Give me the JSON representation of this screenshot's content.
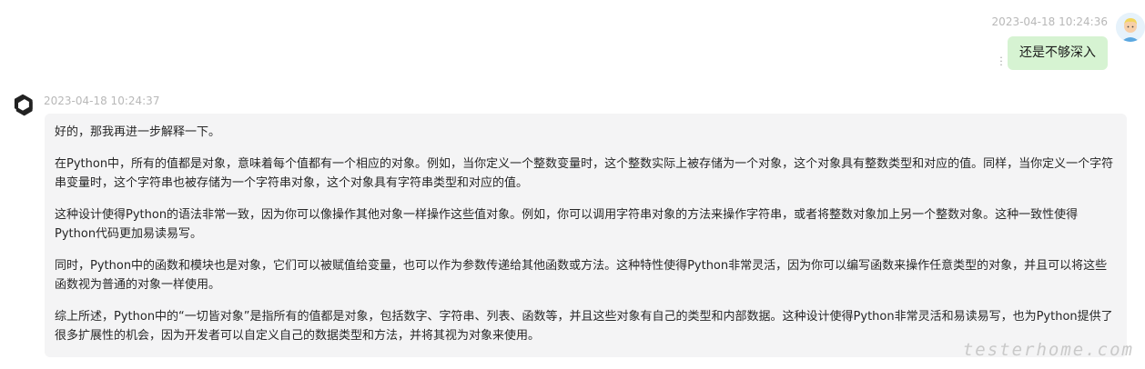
{
  "user_message": {
    "timestamp": "2023-04-18 10:24:36",
    "text": "还是不够深入",
    "avatar_icon": "user-avatar-icon",
    "bubble_color": "#d6f3d2"
  },
  "ai_message": {
    "timestamp": "2023-04-18 10:24:37",
    "avatar_icon": "openai-logo-icon",
    "bubble_color": "#f4f4f5",
    "paragraphs": [
      "好的，那我再进一步解释一下。",
      "在Python中，所有的值都是对象，意味着每个值都有一个相应的对象。例如，当你定义一个整数变量时，这个整数实际上被存储为一个对象，这个对象具有整数类型和对应的值。同样，当你定义一个字符串变量时，这个字符串也被存储为一个字符串对象，这个对象具有字符串类型和对应的值。",
      "这种设计使得Python的语法非常一致，因为你可以像操作其他对象一样操作这些值对象。例如，你可以调用字符串对象的方法来操作字符串，或者将整数对象加上另一个整数对象。这种一致性使得Python代码更加易读易写。",
      "同时，Python中的函数和模块也是对象，它们可以被赋值给变量，也可以作为参数传递给其他函数或方法。这种特性使得Python非常灵活，因为你可以编写函数来操作任意类型的对象，并且可以将这些函数视为普通的对象一样使用。",
      "综上所述，Python中的“一切皆对象”是指所有的值都是对象，包括数字、字符串、列表、函数等，并且这些对象有自己的类型和内部数据。这种设计使得Python非常灵活和易读易写，也为Python提供了很多扩展性的机会，因为开发者可以自定义自己的数据类型和方法，并将其视为对象来使用。"
    ]
  },
  "watermark": "testerhome.com"
}
